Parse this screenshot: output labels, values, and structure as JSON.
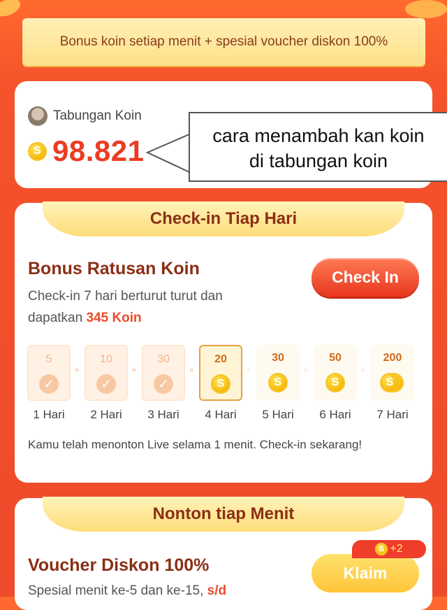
{
  "banner": {
    "text": "Bonus koin setiap menit + spesial voucher diskon 100%"
  },
  "savings": {
    "label": "Tabungan Koin",
    "amount": "98.821",
    "coin_symbol": "S"
  },
  "callout": {
    "line1": "cara menambah kan koin",
    "line2": "di tabungan koin"
  },
  "checkin": {
    "ribbon": "Check-in Tiap Hari",
    "title": "Bonus Ratusan Koin",
    "desc_prefix": "Check-in 7 hari berturut turut dan dapatkan",
    "desc_highlight": "345 Koin",
    "button": "Check In",
    "days": [
      {
        "amount": "5",
        "label": "1 Hari",
        "state": "done"
      },
      {
        "amount": "10",
        "label": "2 Hari",
        "state": "done"
      },
      {
        "amount": "30",
        "label": "3 Hari",
        "state": "done"
      },
      {
        "amount": "20",
        "label": "4 Hari",
        "state": "today"
      },
      {
        "amount": "30",
        "label": "5 Hari",
        "state": "future"
      },
      {
        "amount": "50",
        "label": "6 Hari",
        "state": "future"
      },
      {
        "amount": "200",
        "label": "7 Hari",
        "state": "future"
      }
    ],
    "message": "Kamu telah menonton Live selama 1 menit. Check-in sekarang!"
  },
  "watch": {
    "ribbon": "Nonton tiap Menit",
    "title": "Voucher Diskon 100%",
    "desc_prefix": "Spesial menit ke-5 dan ke-15,",
    "desc_highlight": "s/d",
    "button": "Klaim",
    "badge": "+2"
  },
  "colors": {
    "accent": "#ec3c22",
    "background": "#f5532b",
    "title": "#8a2f16",
    "coin": "#f5b400"
  }
}
